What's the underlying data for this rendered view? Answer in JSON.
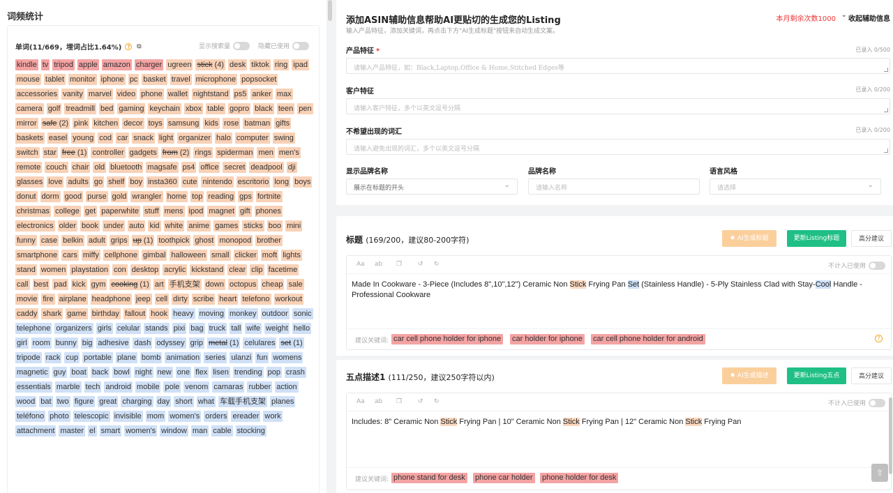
{
  "left": {
    "title": "词频统计",
    "header": "单词(11/669，埋词占比1.64%)",
    "toggle_search_volume": "显示搜索量",
    "toggle_hide_used": "隐藏已使用",
    "keywords": [
      {
        "t": "kindle",
        "c": "red"
      },
      {
        "t": "tv",
        "c": "red"
      },
      {
        "t": "tripod",
        "c": "red"
      },
      {
        "t": "apple",
        "c": "red"
      },
      {
        "t": "amazon",
        "c": "red"
      },
      {
        "t": "charger",
        "c": "red"
      },
      {
        "t": "ugreen",
        "c": "ora"
      },
      {
        "t": "stick",
        "c": "ora",
        "n": "(4)",
        "u": true
      },
      {
        "t": "desk",
        "c": "ora"
      },
      {
        "t": "tiktok",
        "c": "ora"
      },
      {
        "t": "ring",
        "c": "ora"
      },
      {
        "t": "ipad",
        "c": "ora"
      },
      {
        "t": "mouse",
        "c": "ora"
      },
      {
        "t": "tablet",
        "c": "ora"
      },
      {
        "t": "monitor",
        "c": "ora"
      },
      {
        "t": "iphone",
        "c": "ora"
      },
      {
        "t": "pc",
        "c": "ora"
      },
      {
        "t": "basket",
        "c": "ora"
      },
      {
        "t": "travel",
        "c": "ora"
      },
      {
        "t": "microphone",
        "c": "ora"
      },
      {
        "t": "popsocket",
        "c": "ora"
      },
      {
        "t": "accessories",
        "c": "ora"
      },
      {
        "t": "vanity",
        "c": "ora"
      },
      {
        "t": "marvel",
        "c": "ora"
      },
      {
        "t": "video",
        "c": "ora"
      },
      {
        "t": "phone",
        "c": "ora"
      },
      {
        "t": "wallet",
        "c": "ora"
      },
      {
        "t": "nightstand",
        "c": "ora"
      },
      {
        "t": "ps5",
        "c": "ora"
      },
      {
        "t": "anker",
        "c": "ora"
      },
      {
        "t": "max",
        "c": "ora"
      },
      {
        "t": "camera",
        "c": "ora"
      },
      {
        "t": "golf",
        "c": "ora"
      },
      {
        "t": "treadmill",
        "c": "ora"
      },
      {
        "t": "bed",
        "c": "ora"
      },
      {
        "t": "gaming",
        "c": "ora"
      },
      {
        "t": "keychain",
        "c": "ora"
      },
      {
        "t": "xbox",
        "c": "ora"
      },
      {
        "t": "table",
        "c": "ora"
      },
      {
        "t": "gopro",
        "c": "ora"
      },
      {
        "t": "black",
        "c": "ora"
      },
      {
        "t": "teen",
        "c": "ora"
      },
      {
        "t": "pen",
        "c": "ora"
      },
      {
        "t": "mirror",
        "c": "ora"
      },
      {
        "t": "safe",
        "c": "ora",
        "n": "(2)",
        "u": true
      },
      {
        "t": "pink",
        "c": "ora"
      },
      {
        "t": "kitchen",
        "c": "ora"
      },
      {
        "t": "decor",
        "c": "ora"
      },
      {
        "t": "toys",
        "c": "ora"
      },
      {
        "t": "samsung",
        "c": "ora"
      },
      {
        "t": "kids",
        "c": "ora"
      },
      {
        "t": "rose",
        "c": "ora"
      },
      {
        "t": "batman",
        "c": "ora"
      },
      {
        "t": "gifts",
        "c": "ora"
      },
      {
        "t": "baskets",
        "c": "ora"
      },
      {
        "t": "easel",
        "c": "ora"
      },
      {
        "t": "young",
        "c": "ora"
      },
      {
        "t": "cod",
        "c": "ora"
      },
      {
        "t": "car",
        "c": "ora"
      },
      {
        "t": "snack",
        "c": "ora"
      },
      {
        "t": "light",
        "c": "ora"
      },
      {
        "t": "organizer",
        "c": "ora"
      },
      {
        "t": "halo",
        "c": "ora"
      },
      {
        "t": "computer",
        "c": "ora"
      },
      {
        "t": "swing",
        "c": "ora"
      },
      {
        "t": "switch",
        "c": "ora"
      },
      {
        "t": "star",
        "c": "ora"
      },
      {
        "t": "free",
        "c": "ora",
        "n": "(1)",
        "u": true
      },
      {
        "t": "controller",
        "c": "ora"
      },
      {
        "t": "gadgets",
        "c": "ora"
      },
      {
        "t": "from",
        "c": "ora",
        "n": "(2)",
        "u": true
      },
      {
        "t": "rings",
        "c": "ora"
      },
      {
        "t": "spiderman",
        "c": "ora"
      },
      {
        "t": "men",
        "c": "ora"
      },
      {
        "t": "men's",
        "c": "ora"
      },
      {
        "t": "remote",
        "c": "ora"
      },
      {
        "t": "couch",
        "c": "ora"
      },
      {
        "t": "chair",
        "c": "ora"
      },
      {
        "t": "old",
        "c": "ora"
      },
      {
        "t": "bluetooth",
        "c": "ora"
      },
      {
        "t": "magsafe",
        "c": "ora"
      },
      {
        "t": "ps4",
        "c": "ora"
      },
      {
        "t": "office",
        "c": "ora"
      },
      {
        "t": "secret",
        "c": "ora"
      },
      {
        "t": "deadpool",
        "c": "ora"
      },
      {
        "t": "dji",
        "c": "ora"
      },
      {
        "t": "glasses",
        "c": "ora"
      },
      {
        "t": "love",
        "c": "ora"
      },
      {
        "t": "adults",
        "c": "ora"
      },
      {
        "t": "go",
        "c": "ora"
      },
      {
        "t": "shelf",
        "c": "ora"
      },
      {
        "t": "boy",
        "c": "ora"
      },
      {
        "t": "insta360",
        "c": "ora"
      },
      {
        "t": "cute",
        "c": "ora"
      },
      {
        "t": "nintendo",
        "c": "ora"
      },
      {
        "t": "escritorio",
        "c": "ora"
      },
      {
        "t": "long",
        "c": "ora"
      },
      {
        "t": "boys",
        "c": "ora"
      },
      {
        "t": "donut",
        "c": "ora"
      },
      {
        "t": "dorm",
        "c": "ora"
      },
      {
        "t": "good",
        "c": "ora"
      },
      {
        "t": "purse",
        "c": "ora"
      },
      {
        "t": "gold",
        "c": "ora"
      },
      {
        "t": "wrangler",
        "c": "ora"
      },
      {
        "t": "home",
        "c": "ora"
      },
      {
        "t": "top",
        "c": "ora"
      },
      {
        "t": "reading",
        "c": "ora"
      },
      {
        "t": "gps",
        "c": "ora"
      },
      {
        "t": "fortnite",
        "c": "ora"
      },
      {
        "t": "christmas",
        "c": "ora"
      },
      {
        "t": "college",
        "c": "ora"
      },
      {
        "t": "get",
        "c": "ora"
      },
      {
        "t": "paperwhite",
        "c": "ora"
      },
      {
        "t": "stuff",
        "c": "ora"
      },
      {
        "t": "mens",
        "c": "ora"
      },
      {
        "t": "ipod",
        "c": "ora"
      },
      {
        "t": "magnet",
        "c": "ora"
      },
      {
        "t": "gift",
        "c": "ora"
      },
      {
        "t": "phones",
        "c": "ora"
      },
      {
        "t": "electronics",
        "c": "ora"
      },
      {
        "t": "older",
        "c": "ora"
      },
      {
        "t": "book",
        "c": "ora"
      },
      {
        "t": "under",
        "c": "ora"
      },
      {
        "t": "auto",
        "c": "ora"
      },
      {
        "t": "kid",
        "c": "ora"
      },
      {
        "t": "white",
        "c": "ora"
      },
      {
        "t": "anime",
        "c": "ora"
      },
      {
        "t": "games",
        "c": "ora"
      },
      {
        "t": "sticks",
        "c": "ora"
      },
      {
        "t": "boo",
        "c": "ora"
      },
      {
        "t": "mini",
        "c": "ora"
      },
      {
        "t": "funny",
        "c": "ora"
      },
      {
        "t": "case",
        "c": "ora"
      },
      {
        "t": "belkin",
        "c": "ora"
      },
      {
        "t": "adult",
        "c": "ora"
      },
      {
        "t": "grips",
        "c": "ora"
      },
      {
        "t": "up",
        "c": "ora",
        "n": "(1)",
        "u": true
      },
      {
        "t": "toothpick",
        "c": "ora"
      },
      {
        "t": "ghost",
        "c": "ora"
      },
      {
        "t": "monopod",
        "c": "ora"
      },
      {
        "t": "brother",
        "c": "ora"
      },
      {
        "t": "smartphone",
        "c": "ora"
      },
      {
        "t": "cars",
        "c": "ora"
      },
      {
        "t": "miffy",
        "c": "ora"
      },
      {
        "t": "cellphone",
        "c": "ora"
      },
      {
        "t": "gimbal",
        "c": "ora"
      },
      {
        "t": "halloween",
        "c": "ora"
      },
      {
        "t": "small",
        "c": "ora"
      },
      {
        "t": "clicker",
        "c": "ora"
      },
      {
        "t": "moft",
        "c": "ora"
      },
      {
        "t": "lights",
        "c": "ora"
      },
      {
        "t": "stand",
        "c": "ora"
      },
      {
        "t": "women",
        "c": "ora"
      },
      {
        "t": "playstation",
        "c": "ora"
      },
      {
        "t": "con",
        "c": "ora"
      },
      {
        "t": "desktop",
        "c": "ora"
      },
      {
        "t": "acrylic",
        "c": "ora"
      },
      {
        "t": "kickstand",
        "c": "ora"
      },
      {
        "t": "clear",
        "c": "ora"
      },
      {
        "t": "clip",
        "c": "ora"
      },
      {
        "t": "facetime",
        "c": "ora"
      },
      {
        "t": "call",
        "c": "ora"
      },
      {
        "t": "best",
        "c": "ora"
      },
      {
        "t": "pad",
        "c": "ora"
      },
      {
        "t": "kick",
        "c": "ora"
      },
      {
        "t": "gym",
        "c": "ora"
      },
      {
        "t": "cooking",
        "c": "ora",
        "n": "(1)",
        "u": true
      },
      {
        "t": "art",
        "c": "ora"
      },
      {
        "t": "手机支架",
        "c": "ora"
      },
      {
        "t": "down",
        "c": "ora"
      },
      {
        "t": "octopus",
        "c": "ora"
      },
      {
        "t": "cheap",
        "c": "ora"
      },
      {
        "t": "sale",
        "c": "ora"
      },
      {
        "t": "movie",
        "c": "ora"
      },
      {
        "t": "fire",
        "c": "ora"
      },
      {
        "t": "airplane",
        "c": "ora"
      },
      {
        "t": "headphone",
        "c": "ora"
      },
      {
        "t": "jeep",
        "c": "ora"
      },
      {
        "t": "cell",
        "c": "ora"
      },
      {
        "t": "dirty",
        "c": "ora"
      },
      {
        "t": "scribe",
        "c": "ora"
      },
      {
        "t": "heart",
        "c": "ora"
      },
      {
        "t": "telefono",
        "c": "ora"
      },
      {
        "t": "workout",
        "c": "ora"
      },
      {
        "t": "caddy",
        "c": "ora"
      },
      {
        "t": "shark",
        "c": "ora"
      },
      {
        "t": "game",
        "c": "ora"
      },
      {
        "t": "birthday",
        "c": "ora"
      },
      {
        "t": "fallout",
        "c": "ora"
      },
      {
        "t": "hook",
        "c": "ora"
      },
      {
        "t": "heavy",
        "c": "blue"
      },
      {
        "t": "moving",
        "c": "blue"
      },
      {
        "t": "monkey",
        "c": "blue"
      },
      {
        "t": "outdoor",
        "c": "blue"
      },
      {
        "t": "sonic",
        "c": "blue"
      },
      {
        "t": "telephone",
        "c": "blue"
      },
      {
        "t": "organizers",
        "c": "blue"
      },
      {
        "t": "girls",
        "c": "blue"
      },
      {
        "t": "celular",
        "c": "blue"
      },
      {
        "t": "stands",
        "c": "blue"
      },
      {
        "t": "pixi",
        "c": "blue"
      },
      {
        "t": "bag",
        "c": "blue"
      },
      {
        "t": "truck",
        "c": "blue"
      },
      {
        "t": "tall",
        "c": "blue"
      },
      {
        "t": "wife",
        "c": "blue"
      },
      {
        "t": "weight",
        "c": "blue"
      },
      {
        "t": "hello",
        "c": "blue"
      },
      {
        "t": "girl",
        "c": "blue"
      },
      {
        "t": "room",
        "c": "blue"
      },
      {
        "t": "bunny",
        "c": "blue"
      },
      {
        "t": "big",
        "c": "blue"
      },
      {
        "t": "adhesive",
        "c": "blue"
      },
      {
        "t": "dash",
        "c": "blue"
      },
      {
        "t": "odyssey",
        "c": "blue"
      },
      {
        "t": "grip",
        "c": "blue"
      },
      {
        "t": "metal",
        "c": "blue",
        "n": "(1)",
        "u": true
      },
      {
        "t": "celulares",
        "c": "blue"
      },
      {
        "t": "set",
        "c": "blue",
        "n": "(1)",
        "u": true
      },
      {
        "t": "tripode",
        "c": "blue"
      },
      {
        "t": "rack",
        "c": "blue"
      },
      {
        "t": "cup",
        "c": "blue"
      },
      {
        "t": "portable",
        "c": "blue"
      },
      {
        "t": "plane",
        "c": "blue"
      },
      {
        "t": "bomb",
        "c": "blue"
      },
      {
        "t": "animation",
        "c": "blue"
      },
      {
        "t": "series",
        "c": "blue"
      },
      {
        "t": "ulanzi",
        "c": "blue"
      },
      {
        "t": "fun",
        "c": "blue"
      },
      {
        "t": "womens",
        "c": "blue"
      },
      {
        "t": "magnetic",
        "c": "blue"
      },
      {
        "t": "guy",
        "c": "blue"
      },
      {
        "t": "boat",
        "c": "blue"
      },
      {
        "t": "back",
        "c": "blue"
      },
      {
        "t": "bowl",
        "c": "blue"
      },
      {
        "t": "night",
        "c": "blue"
      },
      {
        "t": "new",
        "c": "blue"
      },
      {
        "t": "one",
        "c": "blue"
      },
      {
        "t": "flex",
        "c": "blue"
      },
      {
        "t": "lisen",
        "c": "blue"
      },
      {
        "t": "trending",
        "c": "blue"
      },
      {
        "t": "pop",
        "c": "blue"
      },
      {
        "t": "crash",
        "c": "blue"
      },
      {
        "t": "essentials",
        "c": "blue"
      },
      {
        "t": "marble",
        "c": "blue"
      },
      {
        "t": "tech",
        "c": "blue"
      },
      {
        "t": "android",
        "c": "blue"
      },
      {
        "t": "mobile",
        "c": "blue"
      },
      {
        "t": "pole",
        "c": "blue"
      },
      {
        "t": "venom",
        "c": "blue"
      },
      {
        "t": "camaras",
        "c": "blue"
      },
      {
        "t": "rubber",
        "c": "blue"
      },
      {
        "t": "action",
        "c": "blue"
      },
      {
        "t": "wood",
        "c": "blue"
      },
      {
        "t": "bat",
        "c": "blue"
      },
      {
        "t": "two",
        "c": "blue"
      },
      {
        "t": "figure",
        "c": "blue"
      },
      {
        "t": "great",
        "c": "blue"
      },
      {
        "t": "charging",
        "c": "blue"
      },
      {
        "t": "day",
        "c": "blue"
      },
      {
        "t": "short",
        "c": "blue"
      },
      {
        "t": "what",
        "c": "blue"
      },
      {
        "t": "车载手机支架",
        "c": "blue"
      },
      {
        "t": "planes",
        "c": "blue"
      },
      {
        "t": "teléfono",
        "c": "blue"
      },
      {
        "t": "photo",
        "c": "blue"
      },
      {
        "t": "telescopic",
        "c": "blue"
      },
      {
        "t": "invisible",
        "c": "blue"
      },
      {
        "t": "mom",
        "c": "blue"
      },
      {
        "t": "women's",
        "c": "blue"
      },
      {
        "t": "orders",
        "c": "blue"
      },
      {
        "t": "ereader",
        "c": "blue"
      },
      {
        "t": "work",
        "c": "blue"
      },
      {
        "t": "attachment",
        "c": "blue"
      },
      {
        "t": "master",
        "c": "blue"
      },
      {
        "t": "el",
        "c": "blue"
      },
      {
        "t": "smart",
        "c": "blue"
      },
      {
        "t": "women's",
        "c": "blue"
      },
      {
        "t": "window",
        "c": "blue"
      },
      {
        "t": "man",
        "c": "blue"
      },
      {
        "t": "cable",
        "c": "blue"
      },
      {
        "t": "stocking",
        "c": "blue"
      }
    ]
  },
  "form": {
    "title": "添加ASIN辅助信息帮助AI更贴切的生成您的Listing",
    "subtitle": "输入产品特征，添加关键词，再点击下方\"AI生成标题\"按钮来自动生成文案。",
    "remain": "本月剩余次数1000",
    "collapse": "收起辅助信息",
    "product_label": "产品特征",
    "product_count": "已录入 0/500",
    "product_placeholder": "请输入产品特征，如：Black,Laptop,Office & Home,Stitched Edges等",
    "customer_label": "客户特征",
    "customer_count": "已录入 0/200",
    "customer_placeholder": "请输入客户特征，多个以英文逗号分隔",
    "avoid_label": "不希望出现的词汇",
    "avoid_count": "已录入 0/200",
    "avoid_placeholder": "请输入避免出现的词汇，多个以英文逗号分隔",
    "brand_display_label": "显示品牌名称",
    "brand_display_value": "展示在标题的开头",
    "brand_name_label": "品牌名称",
    "brand_name_placeholder": "请输入名称",
    "lang_label": "语言风格",
    "lang_placeholder": "请选择"
  },
  "title_section": {
    "heading": "标题",
    "meta": "(169/200，建议80-200字符)",
    "ai_btn": "AI生成标题",
    "update_btn": "更新Listing标题",
    "high_btn": "高分建议",
    "not_used": "不计入已使用",
    "text_parts": [
      {
        "t": "Made In Cookware - 3-Piece (Includes 8\",10\",12\") Ceramic Non "
      },
      {
        "t": "Stick",
        "h": "o"
      },
      {
        "t": " Frying Pan "
      },
      {
        "t": "Set",
        "h": "b"
      },
      {
        "t": " (Stainless Handle) - 5-Ply Stainless Clad with Stay-"
      },
      {
        "t": "Cool",
        "h": "b"
      },
      {
        "t": " Handle - Professional Cookware"
      }
    ],
    "suggest_label": "建议关键词:",
    "suggest": [
      "car cell phone holder for iphone",
      "car holder for iphone",
      "car cell phone holder for android"
    ]
  },
  "bullet_section": {
    "heading": "五点描述1",
    "meta": "(111/250，建议250字符以内)",
    "ai_btn": "AI生成描述",
    "update_btn": "更新Listing五点",
    "high_btn": "高分建议",
    "not_used": "不计入已使用",
    "text_parts": [
      {
        "t": "Includes: 8\" Ceramic Non "
      },
      {
        "t": "Stick",
        "h": "o"
      },
      {
        "t": " Frying Pan | 10\" Ceramic Non "
      },
      {
        "t": "Stick",
        "h": "o"
      },
      {
        "t": " Frying Pan | 12\" Ceramic Non "
      },
      {
        "t": "Stick",
        "h": "o"
      },
      {
        "t": " Frying Pan"
      }
    ],
    "suggest_label": "建议关键词:",
    "suggest": [
      "phone stand for desk",
      "phone car holder",
      "phone holder for desk"
    ]
  },
  "toolbar": {
    "aa": "Aa",
    "ab": "ab"
  }
}
